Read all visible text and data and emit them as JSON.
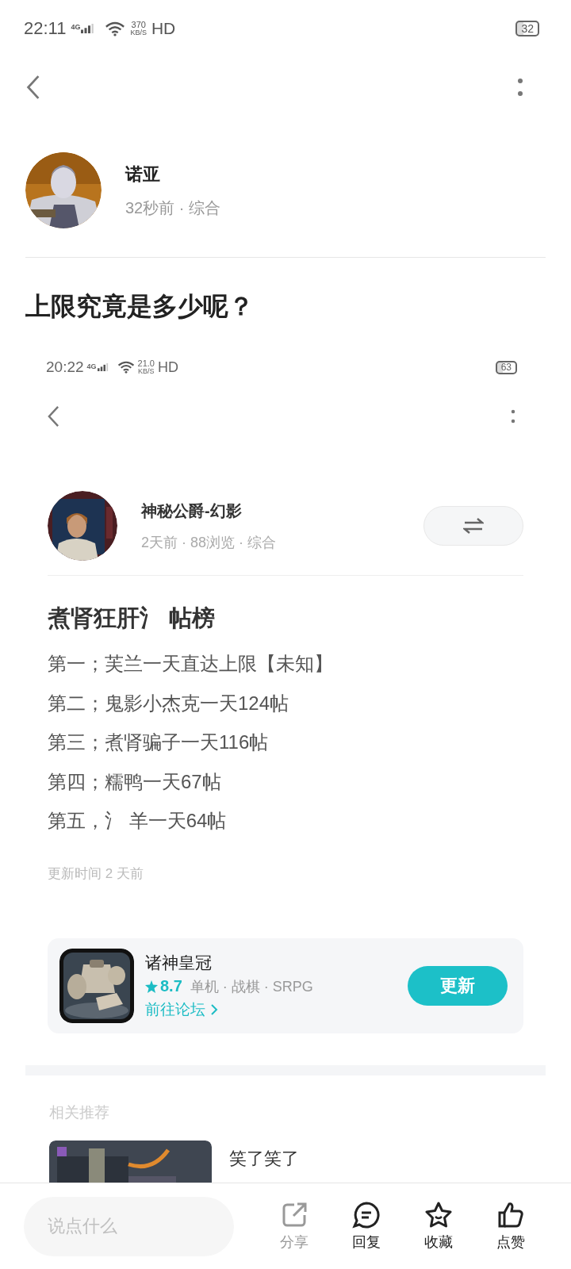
{
  "status_bar": {
    "time": "22:11",
    "network": "4G",
    "speed_value": "370",
    "speed_unit": "KB/S",
    "hd": "HD",
    "battery": "32"
  },
  "post": {
    "author": "诺亚",
    "meta": "32秒前 · 综合",
    "title": "上限究竟是多少呢？"
  },
  "screenshot": {
    "status_bar": {
      "time": "20:22",
      "network": "4G",
      "speed_value": "21.0",
      "speed_unit": "KB/S",
      "hd": "HD",
      "battery": "63"
    },
    "author": "神秘公爵-幻影",
    "meta": "2天前 · 88浏览 · 综合",
    "heading": "煮肾狂肝氵 帖榜",
    "lines": [
      "第一；芙兰一天直达上限【未知】",
      "第二；鬼影小杰克一天124帖",
      "第三；煮肾骗子一天116帖",
      "第四；糯鸭一天67帖",
      "第五，氵 羊一天64帖"
    ],
    "updated": "更新时间 2 天前",
    "game": {
      "name": "诸神皇冠",
      "rating": "8.7",
      "tags": "单机 · 战棋 · SRPG",
      "forum_link": "前往论坛",
      "button": "更新"
    }
  },
  "related": {
    "title": "相关推荐",
    "items": [
      {
        "title": "笑了笑了"
      }
    ]
  },
  "composer": {
    "placeholder": "说点什么"
  },
  "actions": [
    {
      "kind": "share",
      "label": "分享"
    },
    {
      "kind": "reply",
      "label": "回复"
    },
    {
      "kind": "favorite",
      "label": "收藏"
    },
    {
      "kind": "like",
      "label": "点赞"
    }
  ]
}
